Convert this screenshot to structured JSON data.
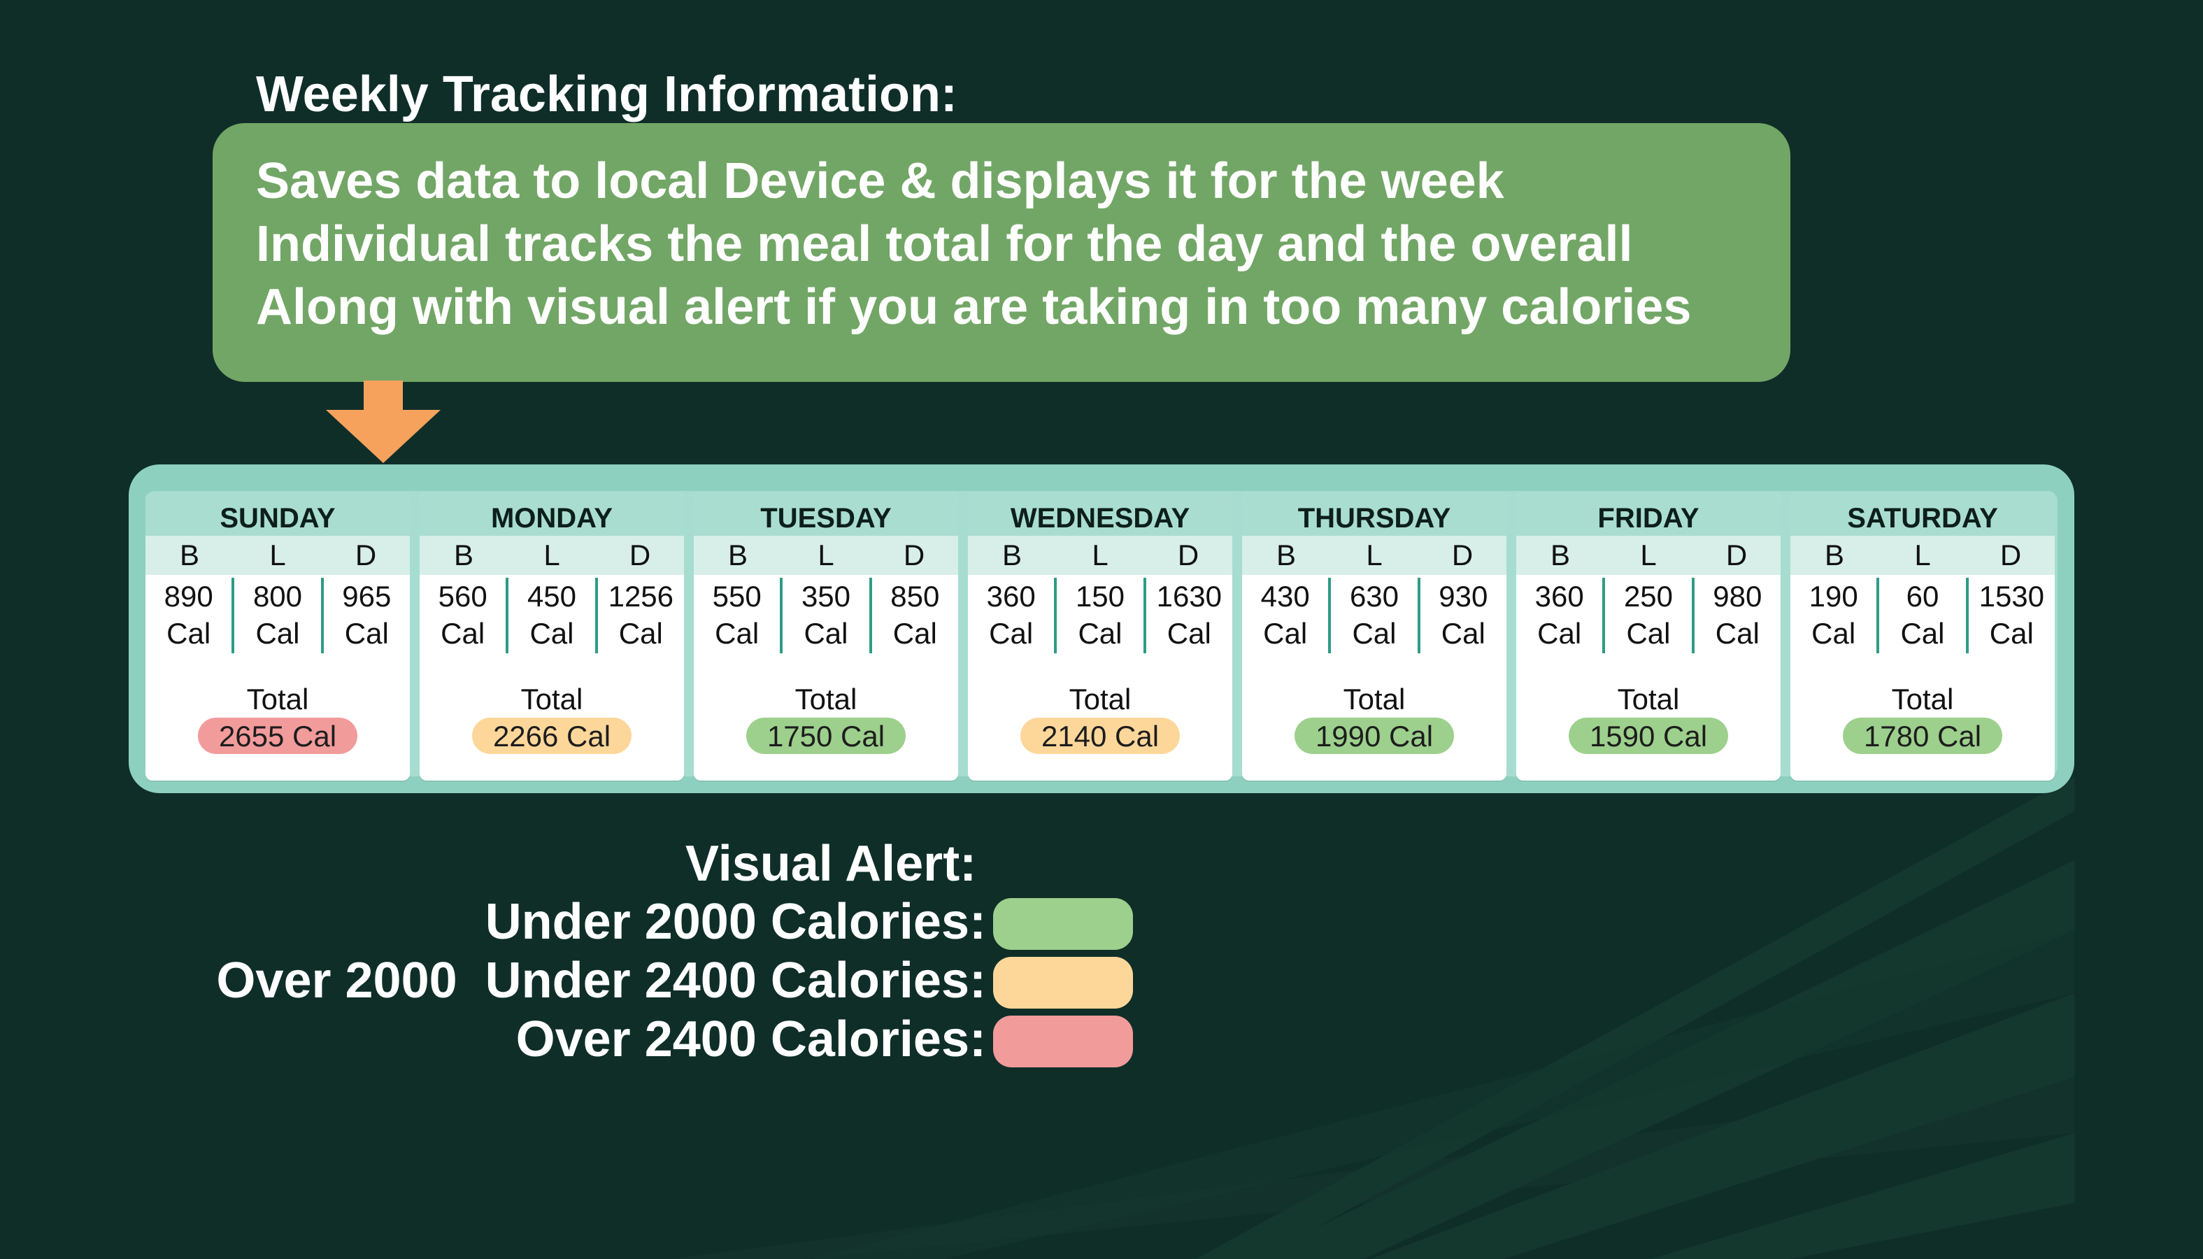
{
  "heading": "Weekly Tracking Information:",
  "info_lines": [
    "Saves data to local Device & displays it for the week",
    "Individual tracks the meal total for the day and the overall",
    "Along with visual alert if you are taking in too many calories"
  ],
  "meal_headers": [
    "B",
    "L",
    "D"
  ],
  "cal_unit": "Cal",
  "total_label": "Total",
  "days": [
    {
      "name": "SUNDAY",
      "meals": [
        "890",
        "800",
        "965"
      ],
      "total": "2655 Cal",
      "status_color": "#f29b9b"
    },
    {
      "name": "MONDAY",
      "meals": [
        "560",
        "450",
        "1256"
      ],
      "total": "2266 Cal",
      "status_color": "#fdd79a"
    },
    {
      "name": "TUESDAY",
      "meals": [
        "550",
        "350",
        "850"
      ],
      "total": "1750 Cal",
      "status_color": "#9dd08c"
    },
    {
      "name": "WEDNESDAY",
      "meals": [
        "360",
        "150",
        "1630"
      ],
      "total": "2140 Cal",
      "status_color": "#fdd79a"
    },
    {
      "name": "THURSDAY",
      "meals": [
        "430",
        "630",
        "930"
      ],
      "total": "1990 Cal",
      "status_color": "#9dd08c"
    },
    {
      "name": "FRIDAY",
      "meals": [
        "360",
        "250",
        "980"
      ],
      "total": "1590 Cal",
      "status_color": "#9dd08c"
    },
    {
      "name": "SATURDAY",
      "meals": [
        "190",
        "60",
        "1530"
      ],
      "total": "1780 Cal",
      "status_color": "#9dd08c"
    }
  ],
  "legend": {
    "title": "Visual Alert:",
    "items": [
      {
        "label": "Under 2000 Calories:",
        "color": "#9dd08c"
      },
      {
        "label": "Over 2000  Under 2400 Calories:",
        "color": "#fdd79a"
      },
      {
        "label": "Over 2400 Calories:",
        "color": "#f29b9b"
      }
    ]
  },
  "colors": {
    "background": "#0f2e28",
    "info_box": "#72a666",
    "arrow": "#f7a25c",
    "tracker_frame": "#8ed0bf"
  },
  "icons": {
    "pointer": "down-arrow-icon"
  }
}
